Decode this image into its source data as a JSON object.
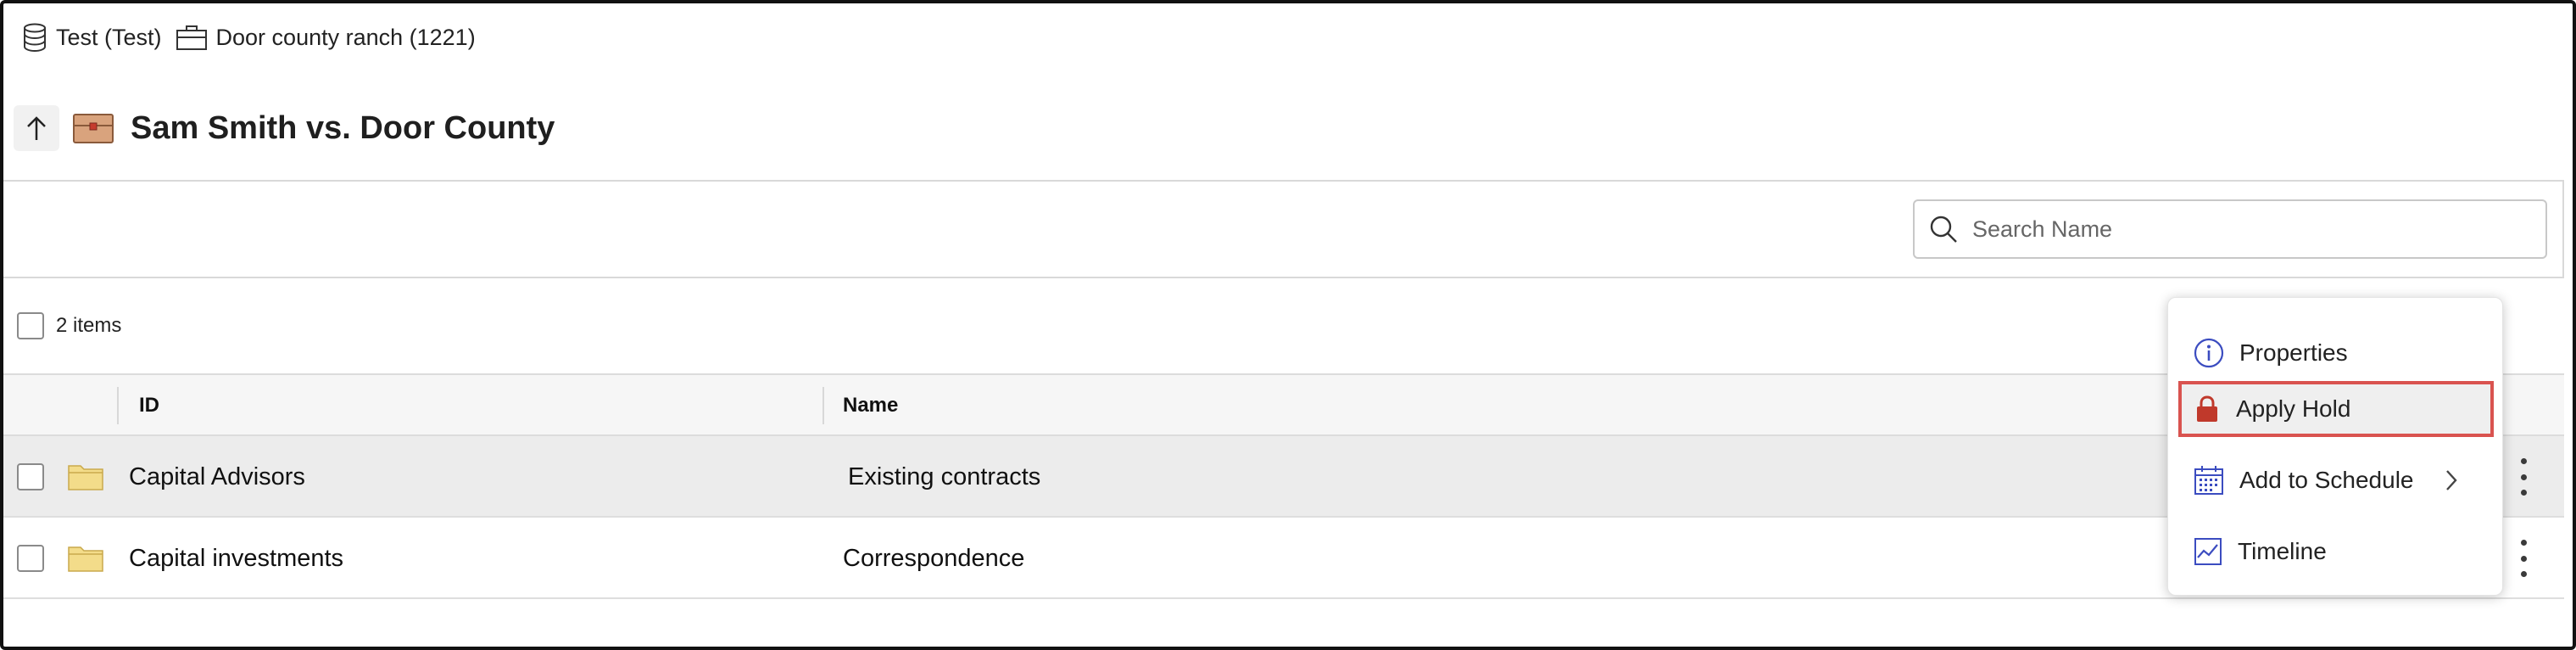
{
  "breadcrumb": {
    "items": [
      {
        "label": "Test (Test)",
        "icon": "database-icon"
      },
      {
        "label": "Door county ranch (1221)",
        "icon": "briefcase-icon"
      }
    ]
  },
  "header": {
    "title": "Sam Smith vs. Door County",
    "up_icon": "arrow-up-icon",
    "case_icon": "case-folder-icon"
  },
  "search": {
    "placeholder": "Search Name",
    "value": ""
  },
  "selection": {
    "count_label": "2 items"
  },
  "table": {
    "columns": [
      {
        "label": "ID"
      },
      {
        "label": "Name"
      }
    ],
    "rows": [
      {
        "id": "Capital Advisors",
        "name": "Existing contracts",
        "highlighted": true
      },
      {
        "id": "Capital investments",
        "name": "Correspondence",
        "highlighted": false
      }
    ]
  },
  "context_menu": {
    "items": [
      {
        "label": "Properties",
        "icon": "info-icon"
      },
      {
        "label": "Apply Hold",
        "icon": "lock-icon",
        "selected": true
      },
      {
        "label": "Add to Schedule",
        "icon": "calendar-icon",
        "has_submenu": true
      },
      {
        "label": "Timeline",
        "icon": "chart-line-icon"
      }
    ]
  },
  "colors": {
    "accent": "#3b4cc0",
    "hold_red": "#c0392b",
    "selection_border": "#d9534f",
    "folder": "#f3dc8a",
    "row_highlight": "#ececec"
  }
}
